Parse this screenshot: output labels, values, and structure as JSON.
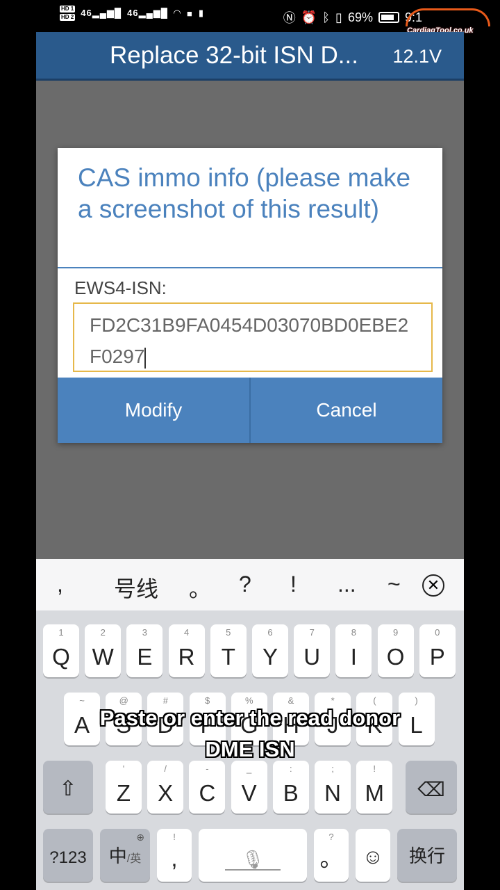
{
  "status_bar": {
    "network_badges": [
      "HD 1",
      "HD 2"
    ],
    "signal_labels": [
      "46",
      "46"
    ],
    "battery_percent": "69%",
    "time": "9:1",
    "right_icons": [
      "nfc-icon",
      "alarm-icon",
      "bluetooth-icon",
      "vibrate-icon"
    ]
  },
  "watermark": {
    "text": "CardiagTool.co.uk"
  },
  "app": {
    "title": "Replace 32-bit ISN D...",
    "voltage": "12.1V"
  },
  "dialog": {
    "title": "CAS immo info (please make a screenshot of this result)",
    "field_label": "EWS4-ISN:",
    "field_value": "FD2C31B9FA0454D03070BD0EBE2F0297",
    "buttons": {
      "modify": "Modify",
      "cancel": "Cancel"
    }
  },
  "keyboard": {
    "suggestions": [
      ",",
      "号线",
      "。",
      "?",
      "!",
      "...",
      "~"
    ],
    "row1": [
      {
        "main": "Q",
        "sub": "1"
      },
      {
        "main": "W",
        "sub": "2"
      },
      {
        "main": "E",
        "sub": "3"
      },
      {
        "main": "R",
        "sub": "4"
      },
      {
        "main": "T",
        "sub": "5"
      },
      {
        "main": "Y",
        "sub": "6"
      },
      {
        "main": "U",
        "sub": "7"
      },
      {
        "main": "I",
        "sub": "8"
      },
      {
        "main": "O",
        "sub": "9"
      },
      {
        "main": "P",
        "sub": "0"
      }
    ],
    "row2": [
      {
        "main": "A",
        "sub": "~"
      },
      {
        "main": "S",
        "sub": "@"
      },
      {
        "main": "D",
        "sub": "#"
      },
      {
        "main": "F",
        "sub": "$"
      },
      {
        "main": "G",
        "sub": "%"
      },
      {
        "main": "H",
        "sub": "&"
      },
      {
        "main": "J",
        "sub": "*"
      },
      {
        "main": "K",
        "sub": "("
      },
      {
        "main": "L",
        "sub": ")"
      }
    ],
    "row3": [
      {
        "main": "Z",
        "sub": "'"
      },
      {
        "main": "X",
        "sub": "/"
      },
      {
        "main": "C",
        "sub": "-"
      },
      {
        "main": "V",
        "sub": "_"
      },
      {
        "main": "B",
        "sub": ":"
      },
      {
        "main": "N",
        "sub": ";"
      },
      {
        "main": "M",
        "sub": "!"
      }
    ],
    "bottom": {
      "symbols": "?123",
      "lang_main": "中",
      "lang_sub": "/英",
      "comma_main": ",",
      "comma_sub": "!",
      "period_main": "。",
      "period_sub": "?",
      "enter": "换行"
    }
  },
  "caption": {
    "line1": "Paste or enter the read donor",
    "line2": "DME ISN"
  },
  "colors": {
    "header": "#2a5a8c",
    "dialog_accent": "#4b82bd",
    "field_border": "#e6b84a",
    "overlay": "#6b6b6b"
  }
}
